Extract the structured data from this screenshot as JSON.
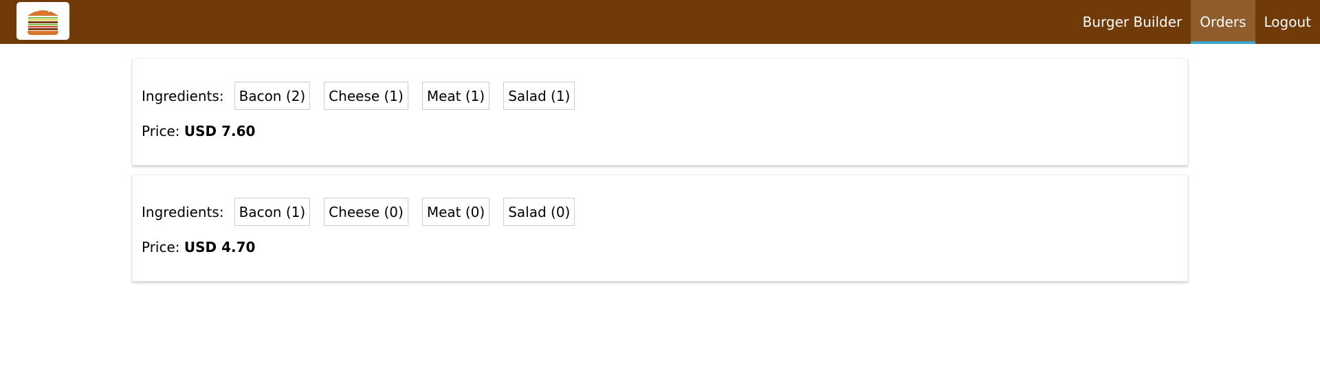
{
  "header": {
    "nav": [
      {
        "label": "Burger Builder",
        "active": false
      },
      {
        "label": "Orders",
        "active": true
      },
      {
        "label": "Logout",
        "active": false
      }
    ],
    "colors": {
      "toolbar": "#703b09",
      "active_tab": "#8f5c2c",
      "active_underline": "#40a4c8"
    },
    "logo_icon": "burger-icon"
  },
  "orders": [
    {
      "ingredients_label": "Ingredients:",
      "ingredients": [
        "Bacon (2)",
        "Cheese (1)",
        "Meat (1)",
        "Salad (1)"
      ],
      "price_label": "Price:",
      "price": "USD 7.60"
    },
    {
      "ingredients_label": "Ingredients:",
      "ingredients": [
        "Bacon (1)",
        "Cheese (0)",
        "Meat (0)",
        "Salad (0)"
      ],
      "price_label": "Price:",
      "price": "USD 4.70"
    }
  ]
}
